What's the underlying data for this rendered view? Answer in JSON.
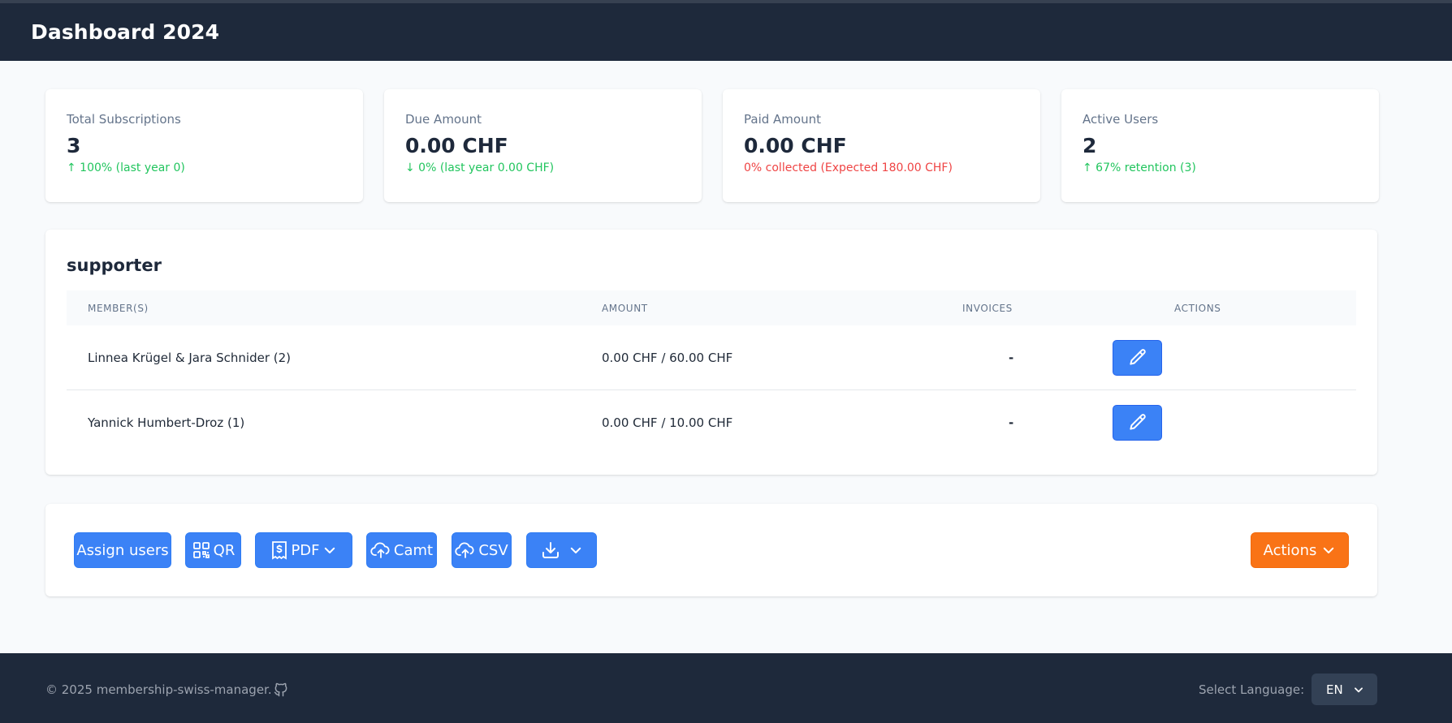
{
  "header": {
    "title": "Dashboard 2024"
  },
  "stats": [
    {
      "label": "Total Subscriptions",
      "value": "3",
      "sub": "↑ 100% (last year 0)",
      "tone": "green"
    },
    {
      "label": "Due Amount",
      "value": "0.00 CHF",
      "sub": "↓ 0% (last year 0.00 CHF)",
      "tone": "green"
    },
    {
      "label": "Paid Amount",
      "value": "0.00 CHF",
      "sub": "0% collected (Expected 180.00 CHF)",
      "tone": "red"
    },
    {
      "label": "Active Users",
      "value": "2",
      "sub": "↑ 67% retention (3)",
      "tone": "green"
    }
  ],
  "panel": {
    "title": "supporter",
    "columns": [
      "MEMBER(S)",
      "AMOUNT",
      "INVOICES",
      "ACTIONS"
    ],
    "rows": [
      {
        "members": "Linnea Krügel & Jara Schnider (2)",
        "amount": "0.00 CHF / 60.00 CHF",
        "invoices": "-"
      },
      {
        "members": "Yannick Humbert-Droz (1)",
        "amount": "0.00 CHF / 10.00 CHF",
        "invoices": "-"
      }
    ]
  },
  "toolbar": {
    "assign_label": "Assign users",
    "qr_label": "QR",
    "pdf_label": "PDF",
    "camt_label": "Camt",
    "csv_label": "CSV",
    "actions_label": "Actions"
  },
  "footer": {
    "copyright": "© 2025 membership-swiss-manager.",
    "language_label": "Select Language:",
    "language_value": "EN"
  },
  "colors": {
    "header_bg": "#1e293b",
    "primary": "#3b82f6",
    "accent_orange": "#f97316",
    "positive": "#22c55e",
    "negative": "#ef4444"
  },
  "icons": [
    "pencil-icon",
    "qr-code-icon",
    "invoice-icon",
    "chevron-down-icon",
    "cloud-upload-icon",
    "download-icon",
    "github-icon"
  ]
}
